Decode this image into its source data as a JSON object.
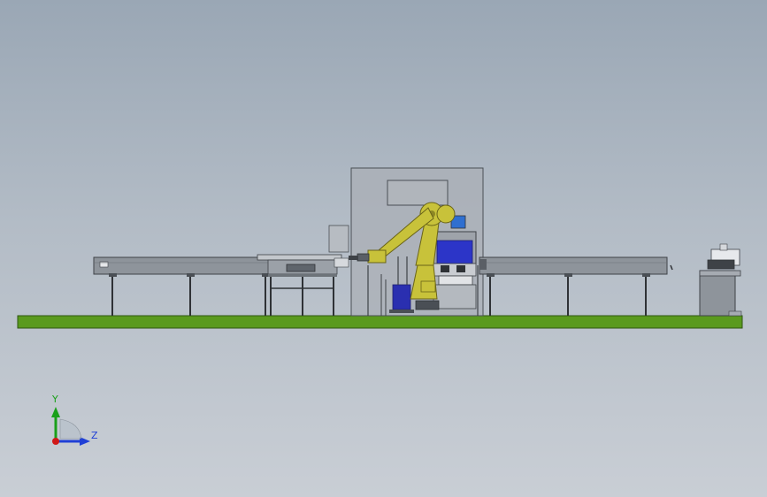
{
  "viewport": {
    "name": "cad-3d-viewport"
  },
  "model": {
    "name": "robotic-conveyor-cell"
  },
  "triad": {
    "y_label": "Y",
    "z_label": "Z",
    "colors": {
      "y": "#1aa01a",
      "z": "#1f3fd6",
      "x": "#d01818"
    }
  },
  "colors": {
    "ground": "#5a9a1e",
    "robot_yellow": "#c8c23a",
    "frame_gray": "#7f858c",
    "enclosure_gray": "#a4aab2",
    "panel_blue": "#2c35c8"
  }
}
